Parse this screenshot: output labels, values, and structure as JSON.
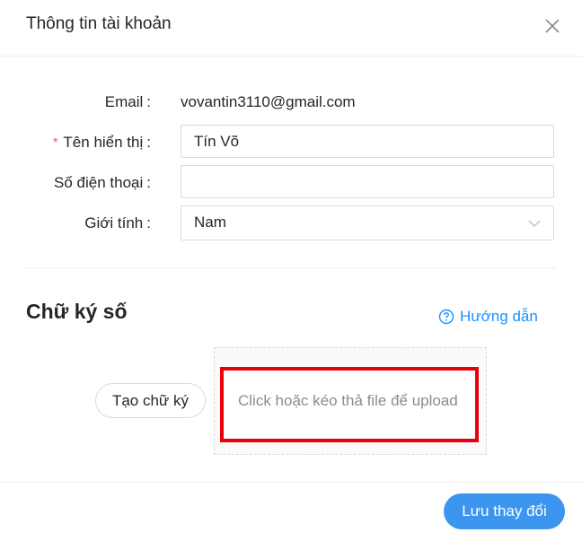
{
  "header": {
    "title": "Thông tin tài khoản",
    "close_icon": "close-icon"
  },
  "form": {
    "email": {
      "label": "Email",
      "colon": ":",
      "value": "vovantin3110@gmail.com"
    },
    "display_name": {
      "required_mark": "*",
      "label": "Tên hiển thị",
      "colon": ":",
      "value": "Tín Võ"
    },
    "phone": {
      "label": "Số điện thoại",
      "colon": ":",
      "value": ""
    },
    "gender": {
      "label": "Giới tính",
      "colon": ":",
      "value": "Nam",
      "icon": "chevron-down-icon"
    }
  },
  "signature": {
    "title": "Chữ ký số",
    "guide_label": "Hướng dẫn",
    "guide_icon": "question-circle-icon",
    "create_button": "Tạo chữ ký",
    "upload_text": "Click hoặc kéo thả file để upload",
    "highlight_color": "#e8000a"
  },
  "footer": {
    "save_button": "Lưu thay đổi",
    "accent": "#3c96f0"
  }
}
